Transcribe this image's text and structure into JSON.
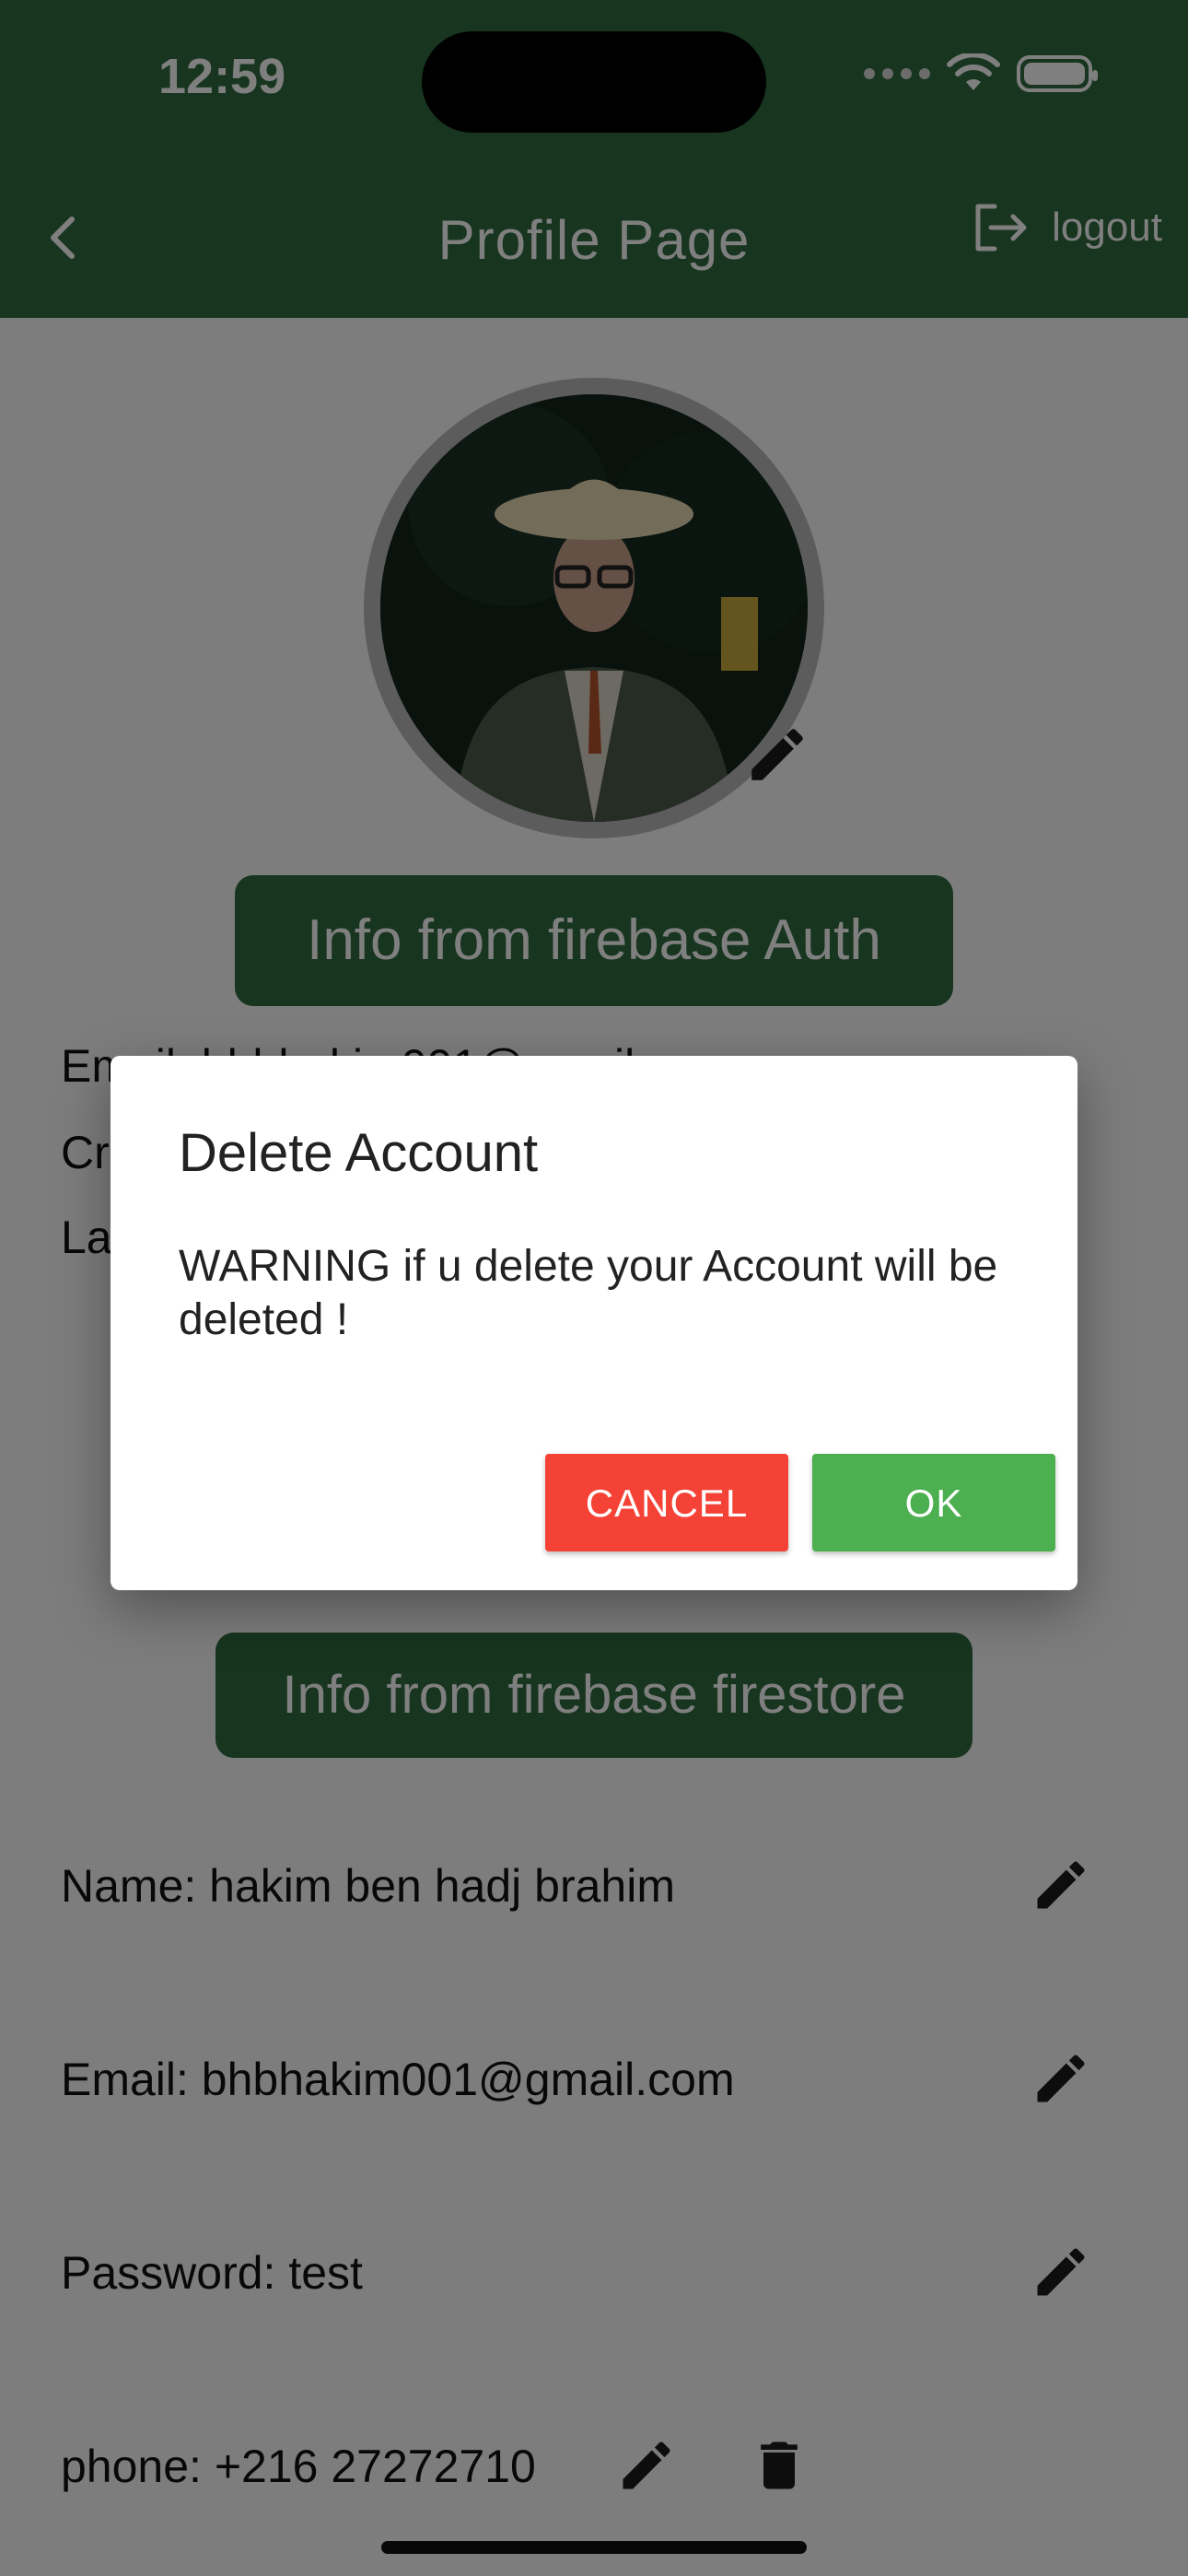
{
  "status_bar": {
    "time": "12:59"
  },
  "app_bar": {
    "title": "Profile Page",
    "logout_label": "logout"
  },
  "auth_section": {
    "heading": "Info from firebase Auth",
    "lines_prefix": [
      "Em",
      "Cr",
      "La"
    ],
    "email_partial": "Email: bhbhakim001@gmail.com"
  },
  "firestore_section": {
    "heading": "Info from firebase firestore",
    "rows": [
      {
        "label": "Name: hakim ben hadj brahim"
      },
      {
        "label": "Email: bhbhakim001@gmail.com"
      },
      {
        "label": "Password: test"
      },
      {
        "label": "phone: +216 27272710"
      }
    ]
  },
  "dialog": {
    "title": "Delete Account",
    "message": "WARNING if u delete your Account will be deleted !",
    "cancel_label": "CANCEL",
    "ok_label": "OK"
  },
  "colors": {
    "app_bar": "#2f6b3f",
    "cancel": "#f44336",
    "ok": "#4caf50"
  },
  "icons": [
    "back-chevron-icon",
    "logout-icon",
    "edit-pencil-icon",
    "trash-icon"
  ]
}
